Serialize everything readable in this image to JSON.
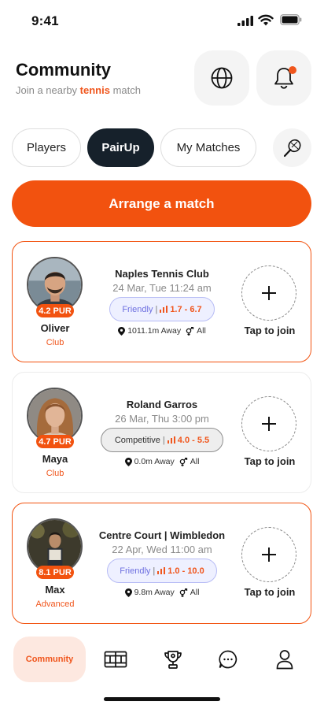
{
  "status_bar": {
    "time": "9:41"
  },
  "header": {
    "title": "Community",
    "subtitle_prefix": "Join a nearby ",
    "subtitle_sport": "tennis",
    "subtitle_suffix": " match",
    "globe_icon": "globe-icon",
    "bell_icon": "bell-icon",
    "has_notification": true
  },
  "tabs": [
    {
      "label": "Players",
      "active": false
    },
    {
      "label": "PairUp",
      "active": true
    },
    {
      "label": "My Matches",
      "active": false
    }
  ],
  "sport_icon": "tennis-racket-icon",
  "arrange_button": {
    "label": "Arrange a match"
  },
  "matches": [
    {
      "player": "Oliver",
      "pur": "4.2 PUR",
      "level": "Club",
      "venue": "Naples Tennis Club",
      "datetime": "24 Mar, Tue 11:24 am",
      "type": "Friendly",
      "range": "1.7 - 6.7",
      "distance": "1011.1m Away",
      "gender": "All",
      "join_label": "Tap to join",
      "highlighted": true
    },
    {
      "player": "Maya",
      "pur": "4.7 PUR",
      "level": "Club",
      "venue": "Roland Garros",
      "datetime": "26 Mar, Thu 3:00 pm",
      "type": "Competitive",
      "range": "4.0 - 5.5",
      "distance": "0.0m Away",
      "gender": "All",
      "join_label": "Tap to join",
      "highlighted": false
    },
    {
      "player": "Max",
      "pur": "8.1 PUR",
      "level": "Advanced",
      "venue": "Centre Court | Wimbledon",
      "datetime": "22 Apr, Wed 11:00 am",
      "type": "Friendly",
      "range": "1.0 - 10.0",
      "distance": "9.8m Away",
      "gender": "All",
      "join_label": "Tap to join",
      "highlighted": true
    }
  ],
  "bottom_nav": {
    "active_label": "Community",
    "icons": [
      "court-icon",
      "trophy-icon",
      "chat-icon",
      "profile-icon"
    ]
  },
  "colors": {
    "accent": "#f2520f",
    "dark": "#16212b",
    "friendly": "#6d6fe0"
  }
}
